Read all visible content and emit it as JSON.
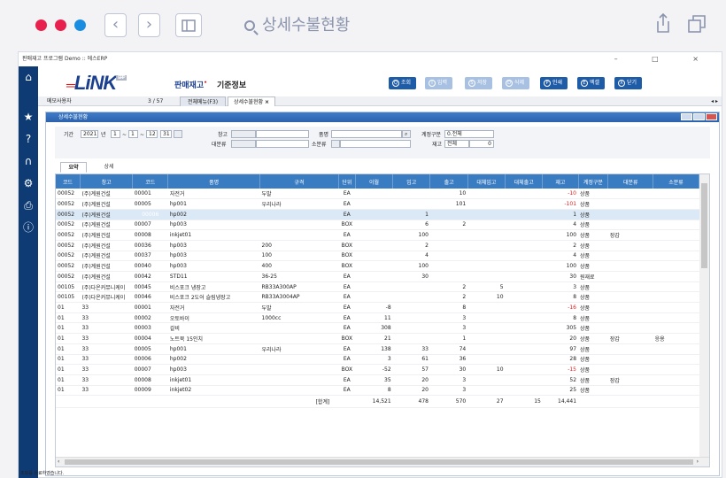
{
  "browser": {
    "url_text": "상세수불현황",
    "dot_colors": [
      "#e8204d",
      "#e8204d",
      "#1a8de0"
    ]
  },
  "window": {
    "title": "판매재고 프로그램 Demo :: 에스ERP",
    "controls": "– □ ×"
  },
  "app": {
    "logo_text": "LiNK",
    "logo_badge": "ERP",
    "menu_primary": "판매재고",
    "menu_secondary": "기준정보",
    "toolbar": [
      {
        "icon": "Q",
        "label": "조회",
        "enabled": true
      },
      {
        "icon": "I",
        "label": "입력",
        "enabled": false
      },
      {
        "icon": "S",
        "label": "저장",
        "enabled": false
      },
      {
        "icon": "D",
        "label": "삭제",
        "enabled": false
      },
      {
        "icon": "P",
        "label": "인쇄",
        "enabled": true
      },
      {
        "icon": "E",
        "label": "엑셀",
        "enabled": true
      },
      {
        "icon": "X",
        "label": "닫기",
        "enabled": true
      }
    ]
  },
  "tabstrip": {
    "memo": "메모사용자",
    "page": "3 / 57",
    "tab1": "전체메뉴(F3)",
    "tab2": "상세수불현황",
    "tab2_close": "×",
    "arrows": "◂ ▸"
  },
  "panel": {
    "title": "상세수불현황",
    "search": {
      "period_label": "기간",
      "year_from": "2021",
      "year_unit": "년",
      "month_from": "1",
      "day_from": "1",
      "tilde": "~",
      "month_to": "12",
      "day_to": "31",
      "warehouse_label": "창고",
      "category_large_label": "대분류",
      "item_label": "품명",
      "category_small_label": "소분류",
      "account_type_label": "계정구분",
      "account_type_value": "0.전체",
      "stock_label": "재고",
      "stock_value": "전체",
      "stock_qty": "0"
    },
    "subtabs": [
      "요약",
      "상세"
    ]
  },
  "grid": {
    "columns": [
      "코드",
      "창고",
      "코드",
      "품명",
      "규격",
      "단위",
      "이월",
      "입고",
      "출고",
      "대체입고",
      "대체출고",
      "재고",
      "계정구분",
      "대분류",
      "소분류"
    ],
    "rows": [
      [
        "00052",
        "(주)계원건설",
        "00001",
        "자전거",
        "두발",
        "EA",
        "",
        "",
        "10",
        "",
        "",
        "-10",
        "상품",
        "",
        ""
      ],
      [
        "00052",
        "(주)계원건설",
        "00005",
        "hp001",
        "우리나라",
        "EA",
        "",
        "",
        "101",
        "",
        "",
        "-101",
        "상품",
        "",
        ""
      ],
      [
        "00052",
        "(주)계원건설",
        "00006",
        "hp002",
        "",
        "EA",
        "",
        "1",
        "",
        "",
        "",
        "1",
        "상품",
        "",
        ""
      ],
      [
        "00052",
        "(주)계원건설",
        "00007",
        "hp003",
        "",
        "BOX",
        "",
        "6",
        "2",
        "",
        "",
        "4",
        "상품",
        "",
        ""
      ],
      [
        "00052",
        "(주)계원건설",
        "00008",
        "inkjet01",
        "",
        "EA",
        "",
        "100",
        "",
        "",
        "",
        "100",
        "상품",
        "장갑",
        ""
      ],
      [
        "00052",
        "(주)계원건설",
        "00036",
        "hp003",
        "200",
        "BOX",
        "",
        "2",
        "",
        "",
        "",
        "2",
        "상품",
        "",
        ""
      ],
      [
        "00052",
        "(주)계원건설",
        "00037",
        "hp003",
        "100",
        "BOX",
        "",
        "4",
        "",
        "",
        "",
        "4",
        "상품",
        "",
        ""
      ],
      [
        "00052",
        "(주)계원건설",
        "00040",
        "hp003",
        "400",
        "BOX",
        "",
        "100",
        "",
        "",
        "",
        "100",
        "상품",
        "",
        ""
      ],
      [
        "00052",
        "(주)계원건설",
        "00042",
        "STD11",
        "36-25",
        "EA",
        "",
        "30",
        "",
        "",
        "",
        "30",
        "원재료",
        "",
        ""
      ],
      [
        "00105",
        "(주)다온커뮤니케이",
        "00045",
        "비스포크 냉장고",
        "RB33A300AP",
        "EA",
        "",
        "",
        "2",
        "5",
        "",
        "3",
        "상품",
        "",
        ""
      ],
      [
        "00105",
        "(주)다온커뮤니케이",
        "00046",
        "비스포크 2도어 슬림냉장고",
        "RB33A3004AP",
        "EA",
        "",
        "",
        "2",
        "10",
        "",
        "8",
        "상품",
        "",
        ""
      ],
      [
        "01",
        "33",
        "00001",
        "자전거",
        "두발",
        "EA",
        "-8",
        "",
        "8",
        "",
        "",
        "-16",
        "상품",
        "",
        ""
      ],
      [
        "01",
        "33",
        "00002",
        "오토바이",
        "1000cc",
        "EA",
        "11",
        "",
        "3",
        "",
        "",
        "8",
        "상품",
        "",
        ""
      ],
      [
        "01",
        "33",
        "00003",
        "갈비",
        "",
        "EA",
        "308",
        "",
        "3",
        "",
        "",
        "305",
        "상품",
        "",
        ""
      ],
      [
        "01",
        "33",
        "00004",
        "노트북 15인치",
        "",
        "BOX",
        "21",
        "",
        "1",
        "",
        "",
        "20",
        "상품",
        "장갑",
        "응용"
      ],
      [
        "01",
        "33",
        "00005",
        "hp001",
        "우리나라",
        "EA",
        "138",
        "33",
        "74",
        "",
        "",
        "97",
        "상품",
        "",
        ""
      ],
      [
        "01",
        "33",
        "00006",
        "hp002",
        "",
        "EA",
        "3",
        "61",
        "36",
        "",
        "",
        "28",
        "상품",
        "",
        ""
      ],
      [
        "01",
        "33",
        "00007",
        "hp003",
        "",
        "BOX",
        "-52",
        "57",
        "30",
        "10",
        "",
        "-15",
        "상품",
        "",
        ""
      ],
      [
        "01",
        "33",
        "00008",
        "inkjet01",
        "",
        "EA",
        "35",
        "20",
        "3",
        "",
        "",
        "52",
        "상품",
        "장갑",
        ""
      ],
      [
        "01",
        "33",
        "00009",
        "inkjet02",
        "",
        "EA",
        "8",
        "20",
        "3",
        "",
        "",
        "25",
        "상품",
        "",
        ""
      ]
    ],
    "selected_row": 2,
    "summary": {
      "label": "[합계]",
      "carry": "14,521",
      "in": "478",
      "out": "570",
      "transfer_in": "27",
      "transfer_out": "15",
      "stock": "14,441"
    }
  },
  "status": {
    "left_text": "조회를 완료하였습니다.",
    "icons": [
      "home-icon",
      "star-icon",
      "help-icon",
      "headset-icon",
      "gear-icon",
      "print-icon",
      "info-icon"
    ]
  }
}
